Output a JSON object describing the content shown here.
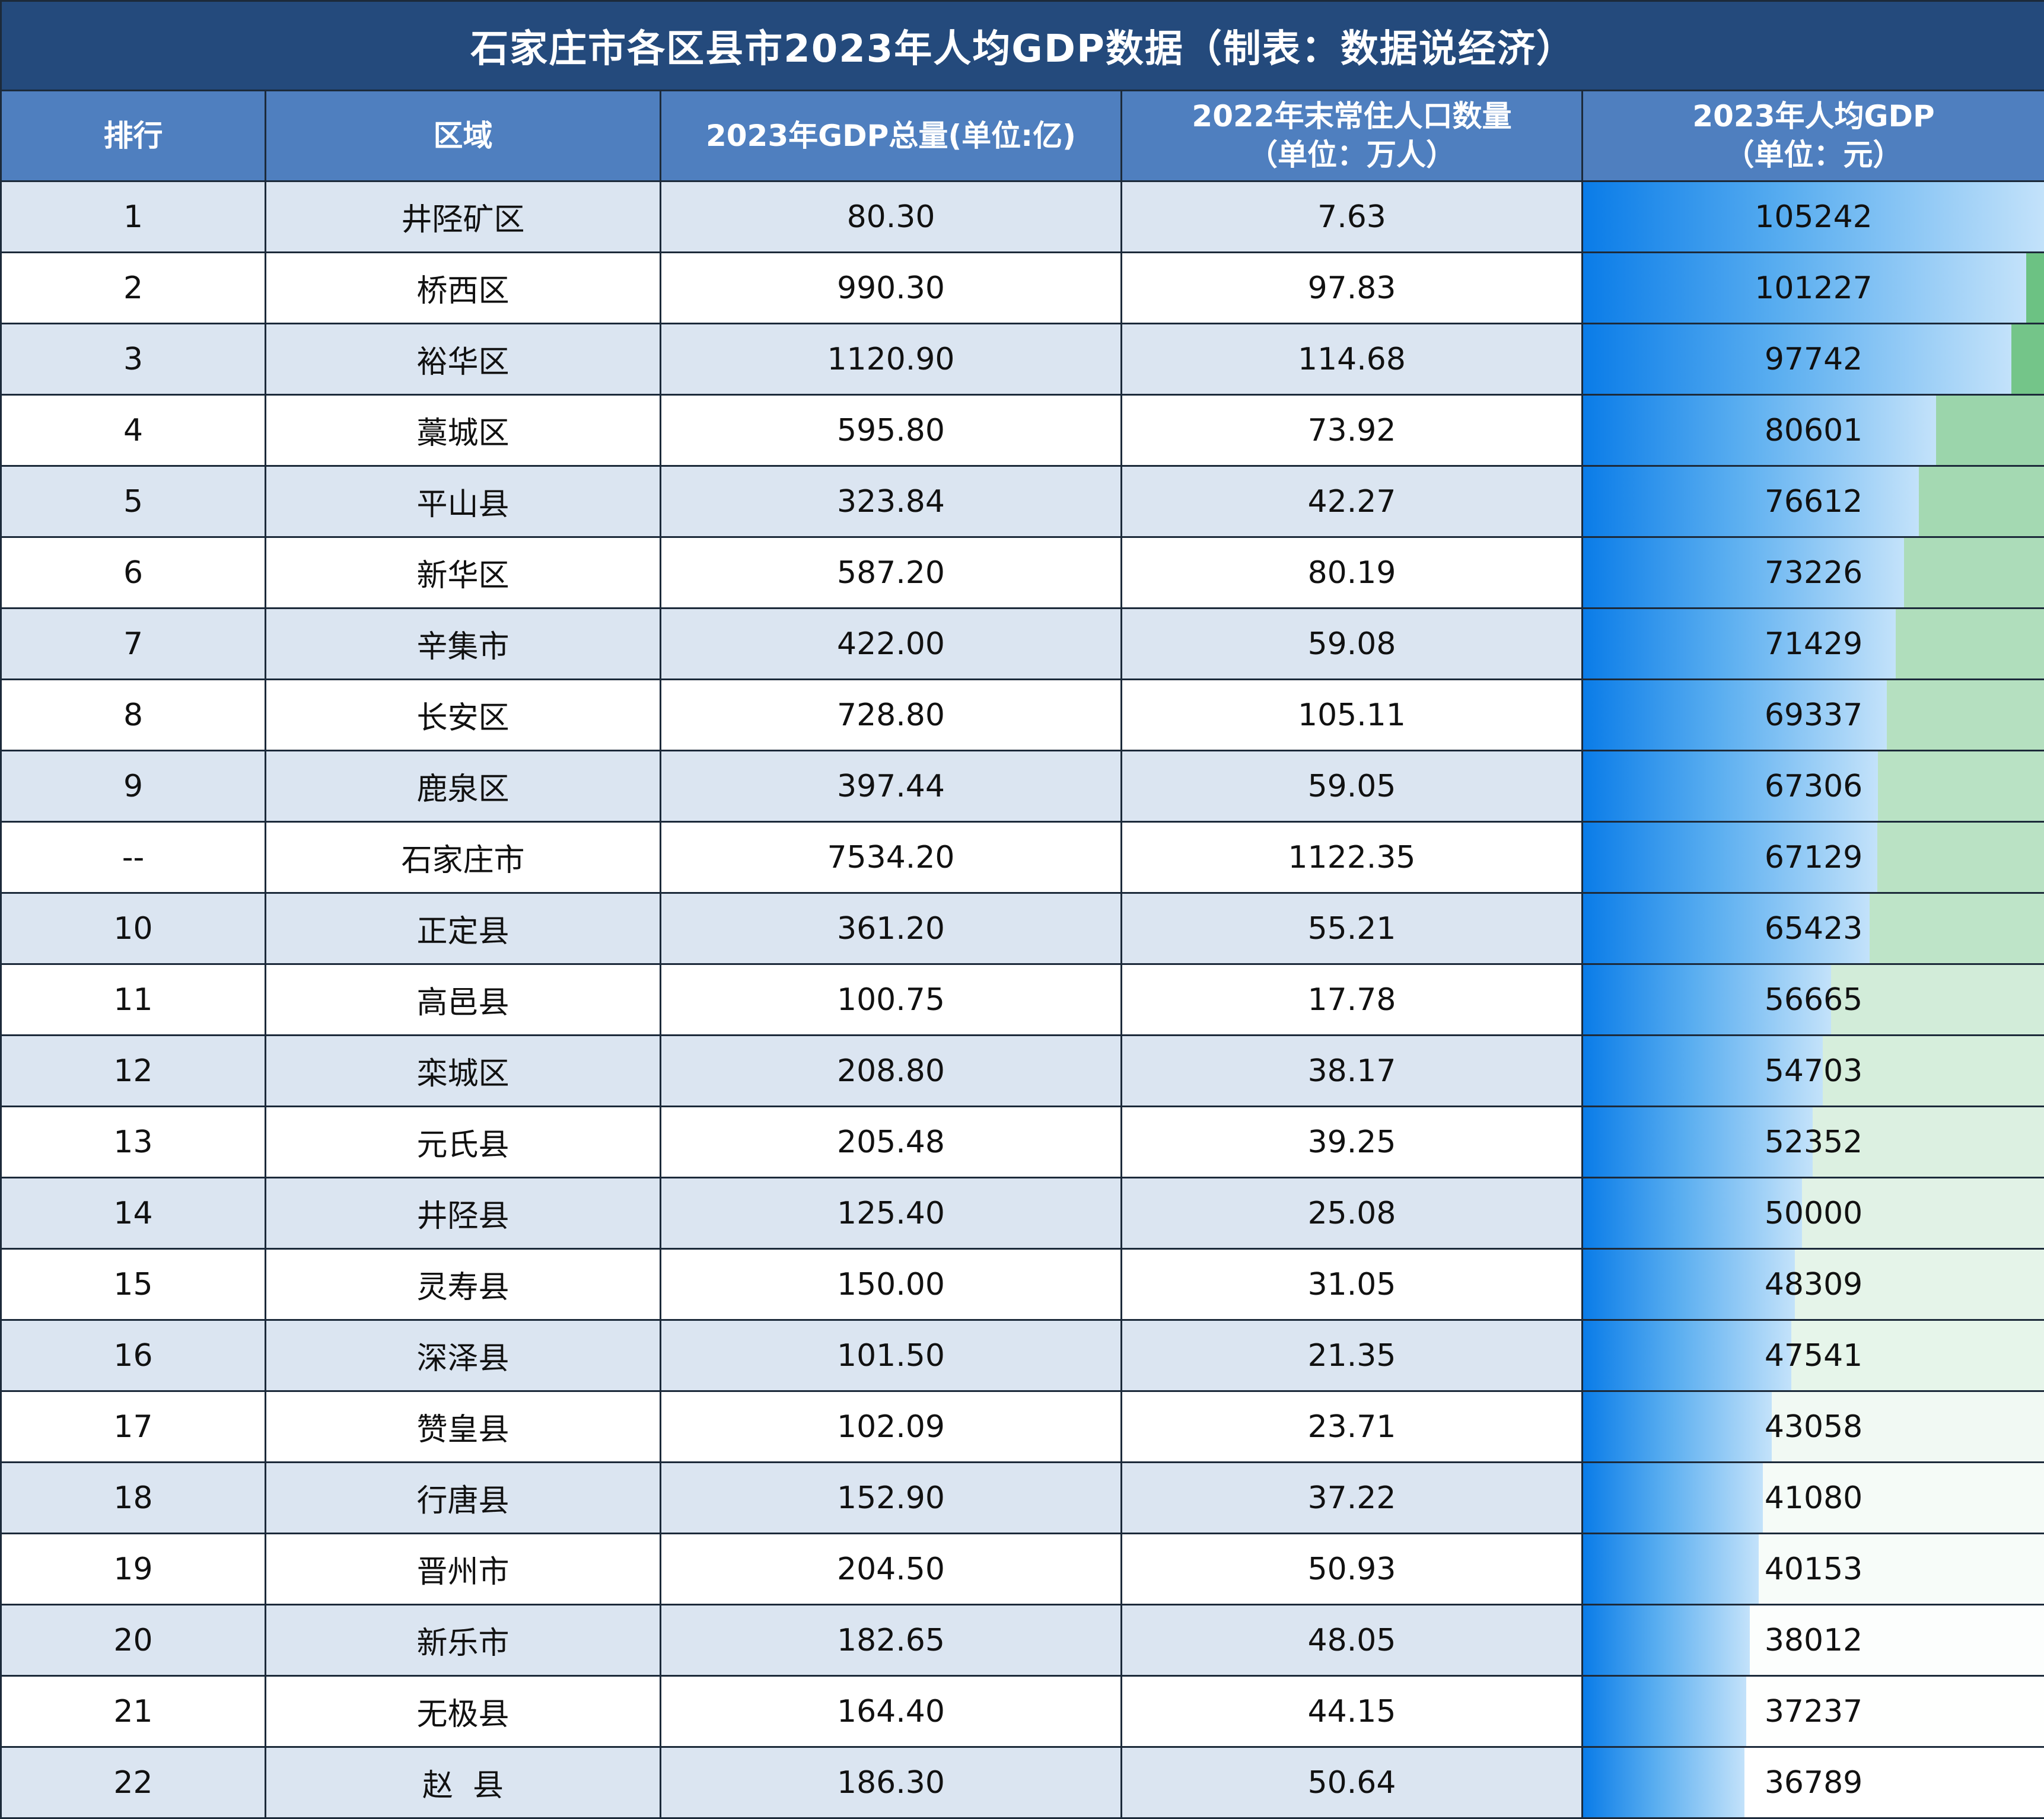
{
  "title": "石家庄市各区县市2023年人均GDP数据（制表：数据说经济）",
  "headers": {
    "rank": "排行",
    "region": "区域",
    "gdp": "2023年GDP总量(单位:亿)",
    "pop_line1": "2022年末常住人口数量",
    "pop_line2": "（单位：万人）",
    "per_capita_line1": "2023年人均GDP",
    "per_capita_line2": "（单位：元）"
  },
  "colors": {
    "title_bg": "#244a7c",
    "header_bg": "#4f7fbf",
    "row_alt_bg": "#dbe5f1",
    "data_bar_blue": "#0a7ce8",
    "color_scale_dark_green": "#63be7b",
    "color_scale_light": "#ffffff"
  },
  "scale": {
    "max": 105242,
    "min": 36789
  },
  "rows": [
    {
      "rank": "1",
      "region": "井陉矿区",
      "gdp": "80.30",
      "population": "7.63",
      "per_capita": "105242",
      "value": 105242
    },
    {
      "rank": "2",
      "region": "桥西区",
      "gdp": "990.30",
      "population": "97.83",
      "per_capita": "101227",
      "value": 101227
    },
    {
      "rank": "3",
      "region": "裕华区",
      "gdp": "1120.90",
      "population": "114.68",
      "per_capita": "97742",
      "value": 97742
    },
    {
      "rank": "4",
      "region": "藁城区",
      "gdp": "595.80",
      "population": "73.92",
      "per_capita": "80601",
      "value": 80601
    },
    {
      "rank": "5",
      "region": "平山县",
      "gdp": "323.84",
      "population": "42.27",
      "per_capita": "76612",
      "value": 76612
    },
    {
      "rank": "6",
      "region": "新华区",
      "gdp": "587.20",
      "population": "80.19",
      "per_capita": "73226",
      "value": 73226
    },
    {
      "rank": "7",
      "region": "辛集市",
      "gdp": "422.00",
      "population": "59.08",
      "per_capita": "71429",
      "value": 71429
    },
    {
      "rank": "8",
      "region": "长安区",
      "gdp": "728.80",
      "population": "105.11",
      "per_capita": "69337",
      "value": 69337
    },
    {
      "rank": "9",
      "region": "鹿泉区",
      "gdp": "397.44",
      "population": "59.05",
      "per_capita": "67306",
      "value": 67306
    },
    {
      "rank": "--",
      "region": "石家庄市",
      "gdp": "7534.20",
      "population": "1122.35",
      "per_capita": "67129",
      "value": 67129,
      "total": true
    },
    {
      "rank": "10",
      "region": "正定县",
      "gdp": "361.20",
      "population": "55.21",
      "per_capita": "65423",
      "value": 65423
    },
    {
      "rank": "11",
      "region": "高邑县",
      "gdp": "100.75",
      "population": "17.78",
      "per_capita": "56665",
      "value": 56665
    },
    {
      "rank": "12",
      "region": "栾城区",
      "gdp": "208.80",
      "population": "38.17",
      "per_capita": "54703",
      "value": 54703
    },
    {
      "rank": "13",
      "region": "元氏县",
      "gdp": "205.48",
      "population": "39.25",
      "per_capita": "52352",
      "value": 52352
    },
    {
      "rank": "14",
      "region": "井陉县",
      "gdp": "125.40",
      "population": "25.08",
      "per_capita": "50000",
      "value": 50000
    },
    {
      "rank": "15",
      "region": "灵寿县",
      "gdp": "150.00",
      "population": "31.05",
      "per_capita": "48309",
      "value": 48309
    },
    {
      "rank": "16",
      "region": "深泽县",
      "gdp": "101.50",
      "population": "21.35",
      "per_capita": "47541",
      "value": 47541
    },
    {
      "rank": "17",
      "region": "赞皇县",
      "gdp": "102.09",
      "population": "23.71",
      "per_capita": "43058",
      "value": 43058
    },
    {
      "rank": "18",
      "region": "行唐县",
      "gdp": "152.90",
      "population": "37.22",
      "per_capita": "41080",
      "value": 41080
    },
    {
      "rank": "19",
      "region": "晋州市",
      "gdp": "204.50",
      "population": "50.93",
      "per_capita": "40153",
      "value": 40153
    },
    {
      "rank": "20",
      "region": "新乐市",
      "gdp": "182.65",
      "population": "48.05",
      "per_capita": "38012",
      "value": 38012
    },
    {
      "rank": "21",
      "region": "无极县",
      "gdp": "164.40",
      "population": "44.15",
      "per_capita": "37237",
      "value": 37237
    },
    {
      "rank": "22",
      "region": "赵  县",
      "gdp": "186.30",
      "population": "50.64",
      "per_capita": "36789",
      "value": 36789
    }
  ]
}
